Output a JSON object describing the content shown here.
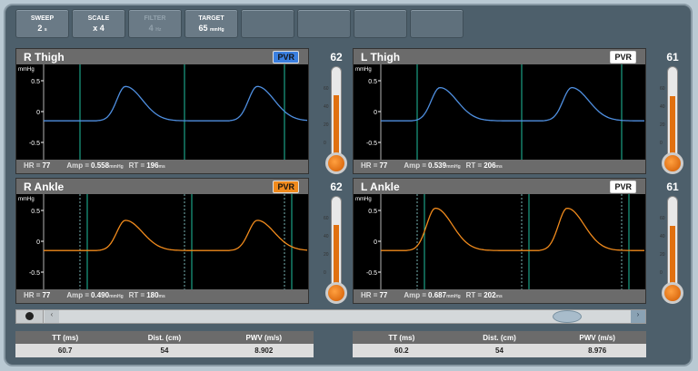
{
  "toolbar": [
    {
      "label": "SWEEP",
      "value": "2",
      "unit": "s",
      "disabled": false
    },
    {
      "label": "SCALE",
      "value": "x 4",
      "unit": "",
      "disabled": false
    },
    {
      "label": "FILTER",
      "value": "4",
      "unit": "Hz",
      "disabled": true
    },
    {
      "label": "TARGET",
      "value": "65",
      "unit": "mmHg",
      "disabled": false
    }
  ],
  "panels": [
    {
      "title": "R Thigh",
      "badge": "PVR",
      "unit": "mmHg",
      "ticks": [
        "0.5",
        "0",
        "-0.5"
      ],
      "hr_label": "HR =",
      "hr": "77",
      "amp_label": "Amp =",
      "amp": "0.558",
      "amp_unit": "mmHg",
      "rt_label": "RT =",
      "rt": "196",
      "rt_unit": "ms",
      "gauge": "62",
      "gauge_ticks": [
        "60",
        "40",
        "20",
        "0"
      ],
      "color": "#4f8fe0",
      "badge_color": "#3a7fe0"
    },
    {
      "title": "L Thigh",
      "badge": "PVR",
      "unit": "mmHg",
      "ticks": [
        "0.5",
        "0",
        "-0.5"
      ],
      "hr_label": "HR =",
      "hr": "77",
      "amp_label": "Amp =",
      "amp": "0.539",
      "amp_unit": "mmHg",
      "rt_label": "RT =",
      "rt": "206",
      "rt_unit": "ms",
      "gauge": "61",
      "gauge_ticks": [
        "60",
        "40",
        "20",
        "0"
      ],
      "color": "#4f8fe0",
      "badge_color": "#ffffff"
    },
    {
      "title": "R Ankle",
      "badge": "PVR",
      "unit": "mmHg",
      "ticks": [
        "0.5",
        "0",
        "-0.5"
      ],
      "hr_label": "HR =",
      "hr": "77",
      "amp_label": "Amp =",
      "amp": "0.490",
      "amp_unit": "mmHg",
      "rt_label": "RT =",
      "rt": "180",
      "rt_unit": "ms",
      "gauge": "62",
      "gauge_ticks": [
        "60",
        "40",
        "20",
        "0"
      ],
      "color": "#f08a1c",
      "badge_color": "#f08a1c"
    },
    {
      "title": "L Ankle",
      "badge": "PVR",
      "unit": "mmHg",
      "ticks": [
        "0.5",
        "0",
        "-0.5"
      ],
      "hr_label": "HR =",
      "hr": "77",
      "amp_label": "Amp =",
      "amp": "0.687",
      "amp_unit": "mmHg",
      "rt_label": "RT =",
      "rt": "202",
      "rt_unit": "ms",
      "gauge": "61",
      "gauge_ticks": [
        "60",
        "40",
        "20",
        "0"
      ],
      "color": "#f08a1c",
      "badge_color": "#ffffff"
    }
  ],
  "tables": [
    {
      "headers": [
        "TT (ms)",
        "Dist. (cm)",
        "PWV (m/s)"
      ],
      "values": [
        "60.7",
        "54",
        "8.902"
      ]
    },
    {
      "headers": [
        "TT (ms)",
        "Dist. (cm)",
        "PWV (m/s)"
      ],
      "values": [
        "60.2",
        "54",
        "8.976"
      ]
    }
  ]
}
